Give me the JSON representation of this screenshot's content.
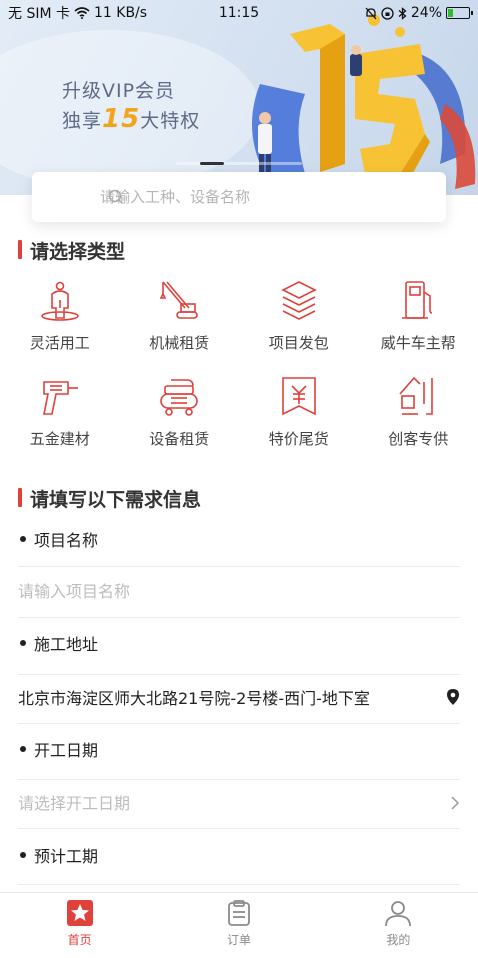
{
  "status_bar": {
    "carrier": "无 SIM 卡",
    "network_speed": "11 KB/s",
    "time": "11:15",
    "battery_percent": "24%",
    "battery_level": 0.24
  },
  "banner": {
    "line1": "升级VIP会员",
    "line2_prefix": "独享",
    "line2_number": "15",
    "line2_suffix": "大特权",
    "art_number": "15",
    "accent_color": "#f2a51a"
  },
  "search": {
    "placeholder": "请输入工种、设备名称"
  },
  "categories": {
    "title": "请选择类型",
    "items": [
      {
        "label": "灵活用工",
        "icon": "worker-icon"
      },
      {
        "label": "机械租赁",
        "icon": "crane-icon"
      },
      {
        "label": "项目发包",
        "icon": "layers-icon"
      },
      {
        "label": "威牛车主帮",
        "icon": "fuel-pump-icon"
      },
      {
        "label": "五金建材",
        "icon": "drill-icon"
      },
      {
        "label": "设备租赁",
        "icon": "air-compressor-icon"
      },
      {
        "label": "特价尾货",
        "icon": "price-tag-icon"
      },
      {
        "label": "创客专供",
        "icon": "maker-icon"
      }
    ],
    "icon_color": "#e0413a"
  },
  "form": {
    "title": "请填写以下需求信息",
    "project_name_label": "项目名称",
    "project_name_placeholder": "请输入项目名称",
    "address_label": "施工地址",
    "address_value": "北京市海淀区师大北路21号院-2号楼-西门-地下室",
    "start_date_label": "开工日期",
    "start_date_placeholder": "请选择开工日期",
    "duration_label": "预计工期"
  },
  "tabbar": {
    "tabs": [
      {
        "label": "首页",
        "icon": "home-star-icon",
        "active": true
      },
      {
        "label": "订单",
        "icon": "clipboard-icon",
        "active": false
      },
      {
        "label": "我的",
        "icon": "user-icon",
        "active": false
      }
    ],
    "active_color": "#e0413a"
  }
}
